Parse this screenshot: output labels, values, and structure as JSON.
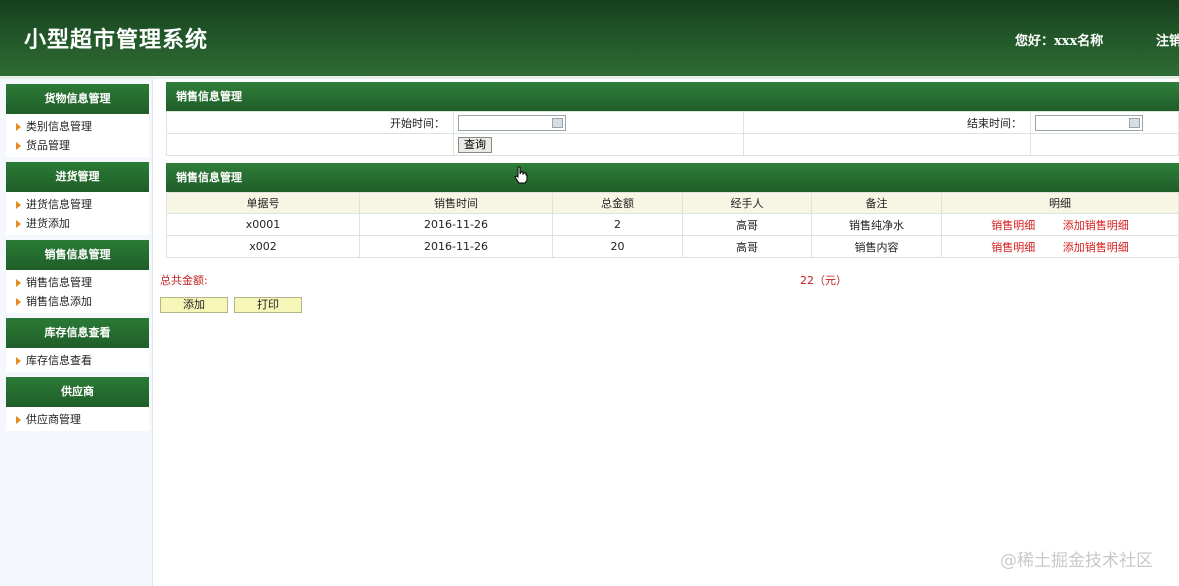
{
  "header": {
    "title": "小型超市管理系统",
    "greeting": "您好：xxx名称",
    "logout": "注销"
  },
  "sidebar": {
    "groups": [
      {
        "title": "货物信息管理",
        "items": [
          "类别信息管理",
          "货品管理"
        ]
      },
      {
        "title": "进货管理",
        "items": [
          "进货信息管理",
          "进货添加"
        ]
      },
      {
        "title": "销售信息管理",
        "items": [
          "销售信息管理",
          "销售信息添加"
        ]
      },
      {
        "title": "库存信息查看",
        "items": [
          "库存信息查看"
        ]
      },
      {
        "title": "供应商",
        "items": [
          "供应商管理"
        ]
      }
    ]
  },
  "search": {
    "panel_title": "销售信息管理",
    "start_label": "开始时间：",
    "start_value": "",
    "end_label": "结束时间：",
    "end_value": "",
    "query_label": "查询"
  },
  "sales": {
    "panel_title": "销售信息管理",
    "columns": [
      "单据号",
      "销售时间",
      "总金额",
      "经手人",
      "备注",
      "明细"
    ],
    "rows": [
      {
        "id": "x0001",
        "time": "2016-11-26",
        "total": "2",
        "handler": "高哥",
        "note": "销售纯净水"
      },
      {
        "id": "x002",
        "time": "2016-11-26",
        "total": "20",
        "handler": "高哥",
        "note": "销售内容"
      }
    ],
    "detail_link": "销售明细",
    "add_detail_link": "添加销售明细",
    "total_label": "总共金额:",
    "total_value": "22（元）"
  },
  "actions": {
    "add": "添加",
    "print": "打印"
  },
  "watermark": "@稀土掘金技术社区",
  "colors": {
    "header_green": "#1f5226",
    "menu_green": "#2b7a36",
    "link_red": "#d61c1c",
    "button_yellow": "#f6f6b9"
  }
}
